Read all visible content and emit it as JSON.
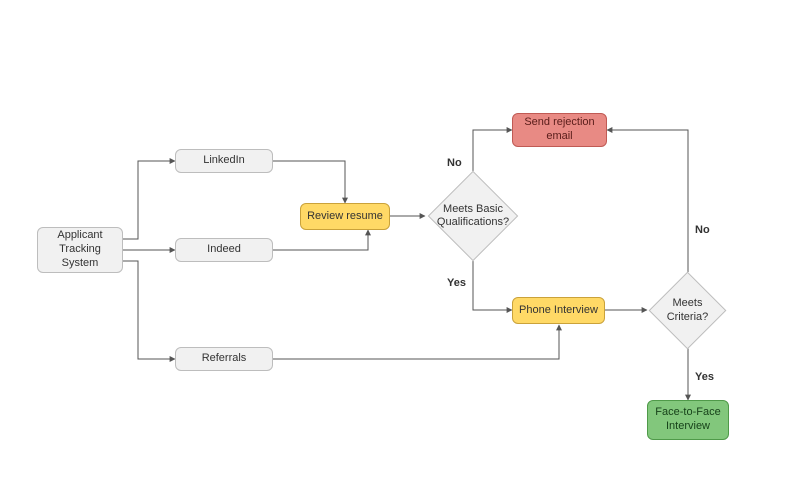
{
  "nodes": {
    "ats": "Applicant Tracking System",
    "linkedin": "LinkedIn",
    "indeed": "Indeed",
    "referrals": "Referrals",
    "review": "Review resume",
    "quals": "Meets Basic Qualifications?",
    "reject": "Send rejection email",
    "phone": "Phone Interview",
    "criteria": "Meets Criteria?",
    "f2f": "Face-to-Face Interview"
  },
  "edgeLabels": {
    "quals_no": "No",
    "quals_yes": "Yes",
    "criteria_no": "No",
    "criteria_yes": "Yes"
  }
}
